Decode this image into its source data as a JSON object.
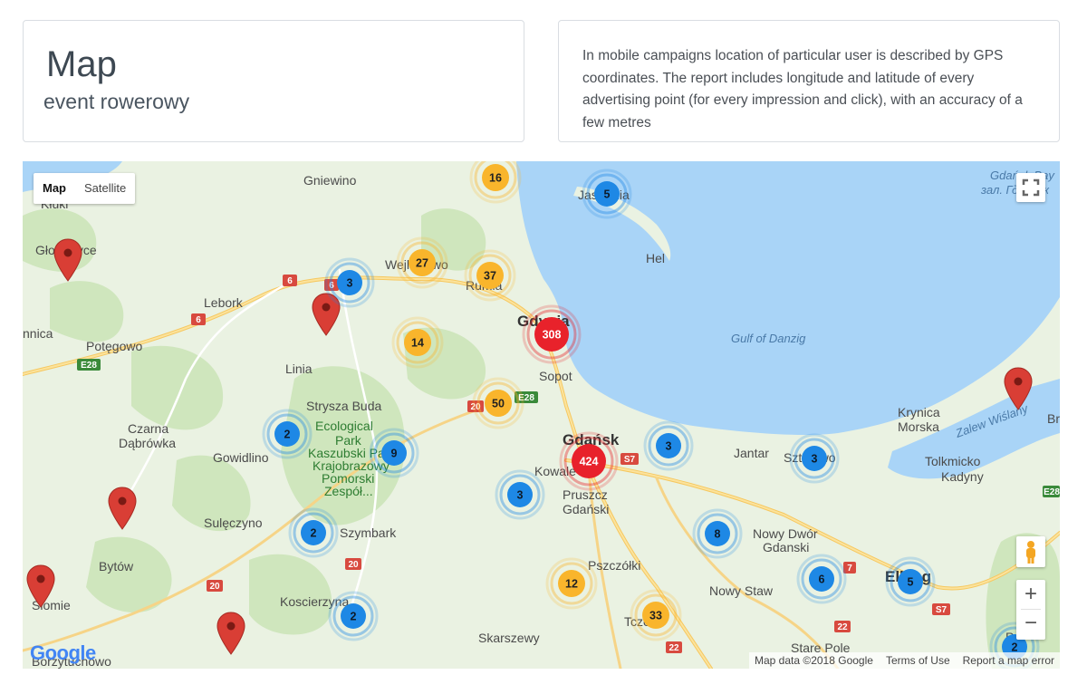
{
  "header": {
    "title": "Map",
    "subtitle": "event rowerowy"
  },
  "info": {
    "text": "In mobile campaigns location of particular user is described by GPS coordinates. The report includes longitude and latitude of every advertising point (for every impression and click), with an accuracy of a few metres"
  },
  "map": {
    "map_type": {
      "map": "Map",
      "satellite": "Satellite"
    },
    "attribution": {
      "data": "Map data ©2018 Google",
      "terms": "Terms of Use",
      "report": "Report a map error"
    },
    "logo": "Google",
    "zoom": {
      "in": "+",
      "out": "−"
    },
    "clusters": [
      {
        "count": "16",
        "level": "medium"
      },
      {
        "count": "5",
        "level": "low"
      },
      {
        "count": "27",
        "level": "medium"
      },
      {
        "count": "37",
        "level": "medium"
      },
      {
        "count": "3",
        "level": "low"
      },
      {
        "count": "308",
        "level": "high"
      },
      {
        "count": "14",
        "level": "medium"
      },
      {
        "count": "50",
        "level": "medium"
      },
      {
        "count": "424",
        "level": "high"
      },
      {
        "count": "3",
        "level": "low"
      },
      {
        "count": "3",
        "level": "low"
      },
      {
        "count": "2",
        "level": "low"
      },
      {
        "count": "9",
        "level": "low"
      },
      {
        "count": "3",
        "level": "low"
      },
      {
        "count": "8",
        "level": "low"
      },
      {
        "count": "2",
        "level": "low"
      },
      {
        "count": "12",
        "level": "medium"
      },
      {
        "count": "6",
        "level": "low"
      },
      {
        "count": "5",
        "level": "low"
      },
      {
        "count": "33",
        "level": "medium"
      },
      {
        "count": "2",
        "level": "low"
      },
      {
        "count": "2",
        "level": "low"
      }
    ],
    "places": [
      "Gniewino",
      "Głowczyce",
      "Lebork",
      "Potęgowo",
      "nnica",
      "Linia",
      "Wejherowo",
      "Rumia",
      "Gdynia",
      "Sopot",
      "Hel",
      "Jastarnia",
      "Gulf of Danzig",
      "Strysza Buda",
      "Ecological",
      "Park",
      "Kaszubski Park",
      "Krajobrazowy",
      "Pomorski",
      "Zespół...",
      "Czarna",
      "Dąbrówka",
      "Gowidlino",
      "Gdańsk",
      "Kowale",
      "Pruszcz",
      "Gdański",
      "Sulęczyno",
      "Szymbark",
      "Bytów",
      "Koscierzyna",
      "Pszczółki",
      "Nowy Dwór",
      "Gdanski",
      "Jantar",
      "Sztutowo",
      "Krynica",
      "Morska",
      "Tolkmicko",
      "Kadyny",
      "Nowy Staw",
      "Elbląg",
      "Skarszewy",
      "Tczew",
      "Stare Pole",
      "Kłuki",
      "Zalew Wiślany",
      "Bra",
      "Gdańsk Bay",
      "зал. Гданьск",
      "Borzytuchowo",
      "Słomie",
      "Pa",
      "E28"
    ],
    "roads": [
      "6",
      "6",
      "6",
      "E28",
      "E28",
      "20",
      "20",
      "20",
      "S7",
      "S7",
      "7",
      "22",
      "22",
      "S7",
      "E28"
    ],
    "colors": {
      "low": "#1e88e5",
      "medium": "#f9b52c",
      "high": "#e8222b",
      "water": "#a9d4f7",
      "land": "#eaf2e2",
      "park": "#c9e4b4",
      "marker": "#d93e35"
    }
  }
}
